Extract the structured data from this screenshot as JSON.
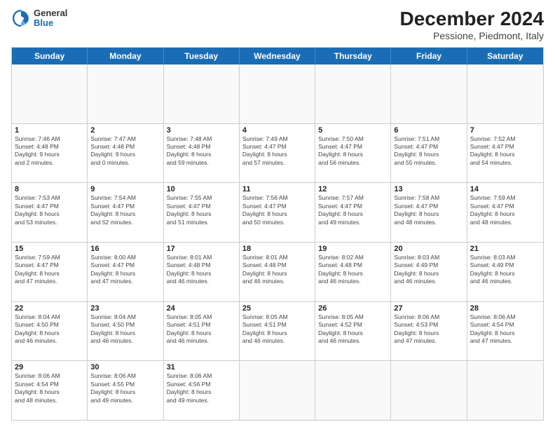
{
  "header": {
    "logo_line1": "General",
    "logo_line2": "Blue",
    "title": "December 2024",
    "subtitle": "Pessione, Piedmont, Italy"
  },
  "calendar": {
    "days_of_week": [
      "Sunday",
      "Monday",
      "Tuesday",
      "Wednesday",
      "Thursday",
      "Friday",
      "Saturday"
    ],
    "weeks": [
      [
        {
          "day": "",
          "info": ""
        },
        {
          "day": "",
          "info": ""
        },
        {
          "day": "",
          "info": ""
        },
        {
          "day": "",
          "info": ""
        },
        {
          "day": "",
          "info": ""
        },
        {
          "day": "",
          "info": ""
        },
        {
          "day": "",
          "info": ""
        }
      ],
      [
        {
          "day": "1",
          "info": "Sunrise: 7:46 AM\nSunset: 4:48 PM\nDaylight: 9 hours\nand 2 minutes."
        },
        {
          "day": "2",
          "info": "Sunrise: 7:47 AM\nSunset: 4:48 PM\nDaylight: 9 hours\nand 0 minutes."
        },
        {
          "day": "3",
          "info": "Sunrise: 7:48 AM\nSunset: 4:48 PM\nDaylight: 8 hours\nand 59 minutes."
        },
        {
          "day": "4",
          "info": "Sunrise: 7:49 AM\nSunset: 4:47 PM\nDaylight: 8 hours\nand 57 minutes."
        },
        {
          "day": "5",
          "info": "Sunrise: 7:50 AM\nSunset: 4:47 PM\nDaylight: 8 hours\nand 56 minutes."
        },
        {
          "day": "6",
          "info": "Sunrise: 7:51 AM\nSunset: 4:47 PM\nDaylight: 8 hours\nand 55 minutes."
        },
        {
          "day": "7",
          "info": "Sunrise: 7:52 AM\nSunset: 4:47 PM\nDaylight: 8 hours\nand 54 minutes."
        }
      ],
      [
        {
          "day": "8",
          "info": "Sunrise: 7:53 AM\nSunset: 4:47 PM\nDaylight: 8 hours\nand 53 minutes."
        },
        {
          "day": "9",
          "info": "Sunrise: 7:54 AM\nSunset: 4:47 PM\nDaylight: 8 hours\nand 52 minutes."
        },
        {
          "day": "10",
          "info": "Sunrise: 7:55 AM\nSunset: 4:47 PM\nDaylight: 8 hours\nand 51 minutes."
        },
        {
          "day": "11",
          "info": "Sunrise: 7:56 AM\nSunset: 4:47 PM\nDaylight: 8 hours\nand 50 minutes."
        },
        {
          "day": "12",
          "info": "Sunrise: 7:57 AM\nSunset: 4:47 PM\nDaylight: 8 hours\nand 49 minutes."
        },
        {
          "day": "13",
          "info": "Sunrise: 7:58 AM\nSunset: 4:47 PM\nDaylight: 8 hours\nand 48 minutes."
        },
        {
          "day": "14",
          "info": "Sunrise: 7:59 AM\nSunset: 4:47 PM\nDaylight: 8 hours\nand 48 minutes."
        }
      ],
      [
        {
          "day": "15",
          "info": "Sunrise: 7:59 AM\nSunset: 4:47 PM\nDaylight: 8 hours\nand 47 minutes."
        },
        {
          "day": "16",
          "info": "Sunrise: 8:00 AM\nSunset: 4:47 PM\nDaylight: 8 hours\nand 47 minutes."
        },
        {
          "day": "17",
          "info": "Sunrise: 8:01 AM\nSunset: 4:48 PM\nDaylight: 8 hours\nand 46 minutes."
        },
        {
          "day": "18",
          "info": "Sunrise: 8:01 AM\nSunset: 4:48 PM\nDaylight: 8 hours\nand 46 minutes."
        },
        {
          "day": "19",
          "info": "Sunrise: 8:02 AM\nSunset: 4:48 PM\nDaylight: 8 hours\nand 46 minutes."
        },
        {
          "day": "20",
          "info": "Sunrise: 8:03 AM\nSunset: 4:49 PM\nDaylight: 8 hours\nand 46 minutes."
        },
        {
          "day": "21",
          "info": "Sunrise: 8:03 AM\nSunset: 4:49 PM\nDaylight: 8 hours\nand 46 minutes."
        }
      ],
      [
        {
          "day": "22",
          "info": "Sunrise: 8:04 AM\nSunset: 4:50 PM\nDaylight: 8 hours\nand 46 minutes."
        },
        {
          "day": "23",
          "info": "Sunrise: 8:04 AM\nSunset: 4:50 PM\nDaylight: 8 hours\nand 46 minutes."
        },
        {
          "day": "24",
          "info": "Sunrise: 8:05 AM\nSunset: 4:51 PM\nDaylight: 8 hours\nand 46 minutes."
        },
        {
          "day": "25",
          "info": "Sunrise: 8:05 AM\nSunset: 4:51 PM\nDaylight: 8 hours\nand 46 minutes."
        },
        {
          "day": "26",
          "info": "Sunrise: 8:05 AM\nSunset: 4:52 PM\nDaylight: 8 hours\nand 46 minutes."
        },
        {
          "day": "27",
          "info": "Sunrise: 8:06 AM\nSunset: 4:53 PM\nDaylight: 8 hours\nand 47 minutes."
        },
        {
          "day": "28",
          "info": "Sunrise: 8:06 AM\nSunset: 4:54 PM\nDaylight: 8 hours\nand 47 minutes."
        }
      ],
      [
        {
          "day": "29",
          "info": "Sunrise: 8:06 AM\nSunset: 4:54 PM\nDaylight: 8 hours\nand 48 minutes."
        },
        {
          "day": "30",
          "info": "Sunrise: 8:06 AM\nSunset: 4:55 PM\nDaylight: 8 hours\nand 49 minutes."
        },
        {
          "day": "31",
          "info": "Sunrise: 8:06 AM\nSunset: 4:56 PM\nDaylight: 8 hours\nand 49 minutes."
        },
        {
          "day": "",
          "info": ""
        },
        {
          "day": "",
          "info": ""
        },
        {
          "day": "",
          "info": ""
        },
        {
          "day": "",
          "info": ""
        }
      ]
    ]
  }
}
